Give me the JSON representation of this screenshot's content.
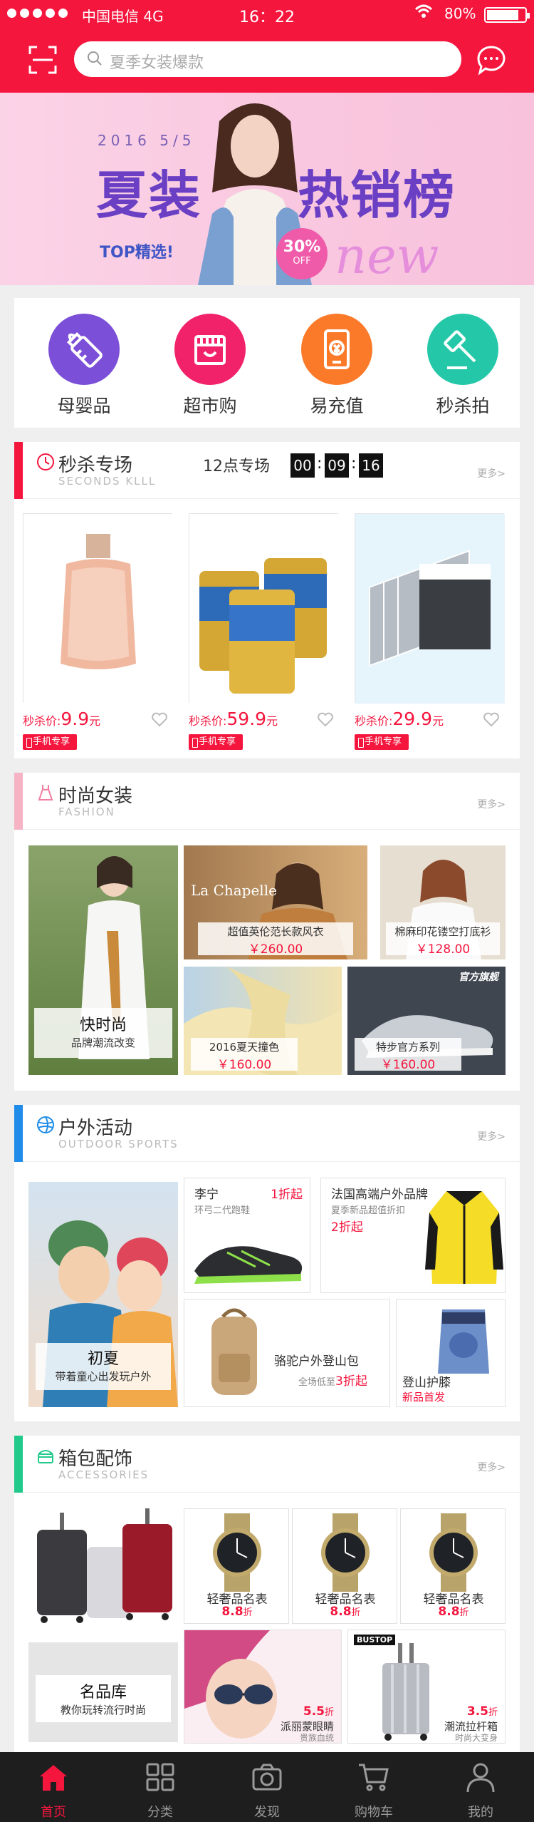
{
  "status": {
    "carrier": "中国电信",
    "network": "4G",
    "time": "16：22",
    "battery": "80%"
  },
  "header": {
    "search_placeholder": "夏季女装爆款"
  },
  "banner": {
    "date": "2016  5/5",
    "title_left": "夏装",
    "title_right": "热销榜",
    "sub": "TOP精选!",
    "discount": "30%",
    "discount_sub": "OFF",
    "new": "new"
  },
  "categories": [
    {
      "label": "母婴品",
      "color": "#7c4fd8"
    },
    {
      "label": "超市购",
      "color": "#f2226a"
    },
    {
      "label": "易充值",
      "color": "#fb7a2a"
    },
    {
      "label": "秒杀拍",
      "color": "#24c8a8"
    }
  ],
  "flash": {
    "title": "秒杀专场",
    "sub": "SECONDS KLLL",
    "label": "12点专场",
    "hh": "00",
    "mm": "09",
    "ss": "16",
    "more": "更多>",
    "products": [
      {
        "price_prefix": "秒杀价:",
        "price": "9.9",
        "unit": "元",
        "tag": "手机专享"
      },
      {
        "price_prefix": "秒杀价:",
        "price": "59.9",
        "unit": "元",
        "tag": "手机专享"
      },
      {
        "price_prefix": "秒杀价:",
        "price": "29.9",
        "unit": "元",
        "tag": "手机专享"
      }
    ]
  },
  "fashion": {
    "title": "时尚女装",
    "sub": "FASHION",
    "more": "更多>",
    "main_title": "快时尚",
    "main_sub": "品牌潮流改变",
    "items": [
      {
        "name": "超值英伦范长款风衣",
        "price": "￥260.00",
        "brand": "La Chapelle"
      },
      {
        "name": "棉麻印花镂空打底衫",
        "price": "￥128.00"
      },
      {
        "name": "2016夏天撞色",
        "price": "￥160.00"
      },
      {
        "name": "特步官方系列",
        "price": "￥160.00",
        "badge": "官方旗舰"
      }
    ]
  },
  "outdoor": {
    "title": "户外活动",
    "sub": "OUTDOOR SPORTS",
    "more": "更多>",
    "main_title": "初夏",
    "main_sub": "带着童心出发玩户外",
    "items": [
      {
        "name": "李宁",
        "sub": "环弓二代跑鞋",
        "rate": "1折起"
      },
      {
        "name": "法国高端户外品牌",
        "sub": "夏季新品超值折扣",
        "rate": "2折起"
      },
      {
        "name": "骆驼户外登山包",
        "sub": "全场低至",
        "rate": "3折起"
      },
      {
        "name": "登山护膝",
        "sub": "新品首发"
      }
    ]
  },
  "acc": {
    "title": "箱包配饰",
    "sub": "ACCESSORIES",
    "more": "更多>",
    "watches": [
      {
        "name": "轻奢品名表",
        "rate": "8.8",
        "unit": "折"
      },
      {
        "name": "轻奢品名表",
        "rate": "8.8",
        "unit": "折"
      },
      {
        "name": "轻奢品名表",
        "rate": "8.8",
        "unit": "折"
      }
    ],
    "main_title": "名品库",
    "main_sub": "教你玩转流行时尚",
    "glasses": {
      "rate": "5.5",
      "unit": "折",
      "name": "派丽蒙眼睛",
      "sub": "贵族血统"
    },
    "luggage": {
      "rate": "3.5",
      "unit": "折",
      "name": "潮流拉杆箱",
      "sub": "时尚大变身",
      "brand": "BUSTOP"
    }
  },
  "tabbar": [
    {
      "label": "首页"
    },
    {
      "label": "分类"
    },
    {
      "label": "发现"
    },
    {
      "label": "购物车"
    },
    {
      "label": "我的"
    }
  ]
}
